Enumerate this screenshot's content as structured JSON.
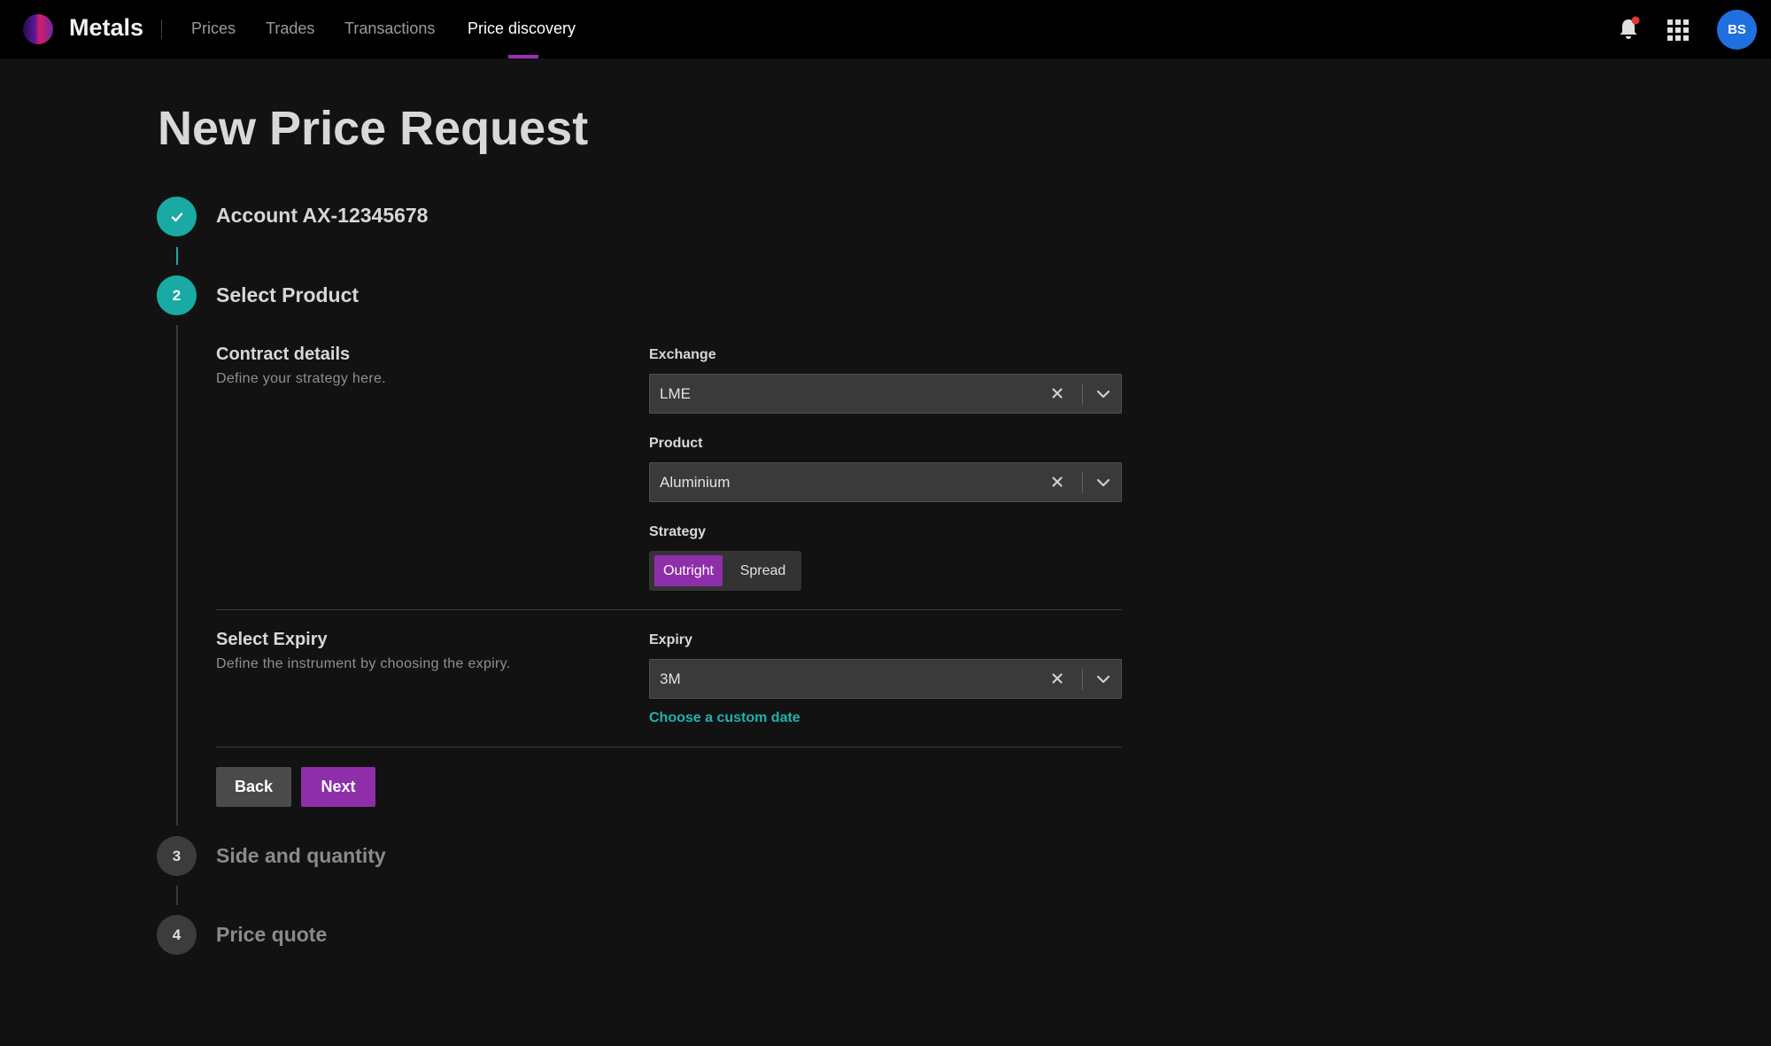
{
  "app": {
    "brand": "Metals"
  },
  "nav": {
    "items": [
      {
        "label": "Prices",
        "active": false
      },
      {
        "label": "Trades",
        "active": false
      },
      {
        "label": "Transactions",
        "active": false
      },
      {
        "label": "Price discovery",
        "active": true
      }
    ],
    "accent_color": "#9c2fb5"
  },
  "header_icons": {
    "bell": "bell-icon",
    "apps": "apps-grid-icon",
    "notification_dot_color": "#e53935"
  },
  "user": {
    "initials": "BS",
    "avatar_color": "#1f6fe0"
  },
  "page": {
    "title": "New Price Request"
  },
  "steps": [
    {
      "number": "1",
      "title": "Account AX-12345678",
      "status": "done"
    },
    {
      "number": "2",
      "title": "Select Product",
      "status": "current"
    },
    {
      "number": "3",
      "title": "Side and quantity",
      "status": "pending"
    },
    {
      "number": "4",
      "title": "Price quote",
      "status": "pending"
    }
  ],
  "contract": {
    "title": "Contract details",
    "subtitle": "Define your strategy here.",
    "exchange": {
      "label": "Exchange",
      "value": "LME"
    },
    "product": {
      "label": "Product",
      "value": "Aluminium"
    },
    "strategy": {
      "label": "Strategy",
      "options": [
        "Outright",
        "Spread"
      ],
      "selected": "Outright"
    }
  },
  "expiry": {
    "title": "Select Expiry",
    "subtitle": "Define the instrument by choosing the expiry.",
    "label": "Expiry",
    "value": "3M",
    "custom_link": "Choose a custom date"
  },
  "actions": {
    "back": "Back",
    "next": "Next"
  },
  "colors": {
    "teal": "#19aaa4",
    "purple": "#8e2ea9",
    "background": "#121212"
  }
}
